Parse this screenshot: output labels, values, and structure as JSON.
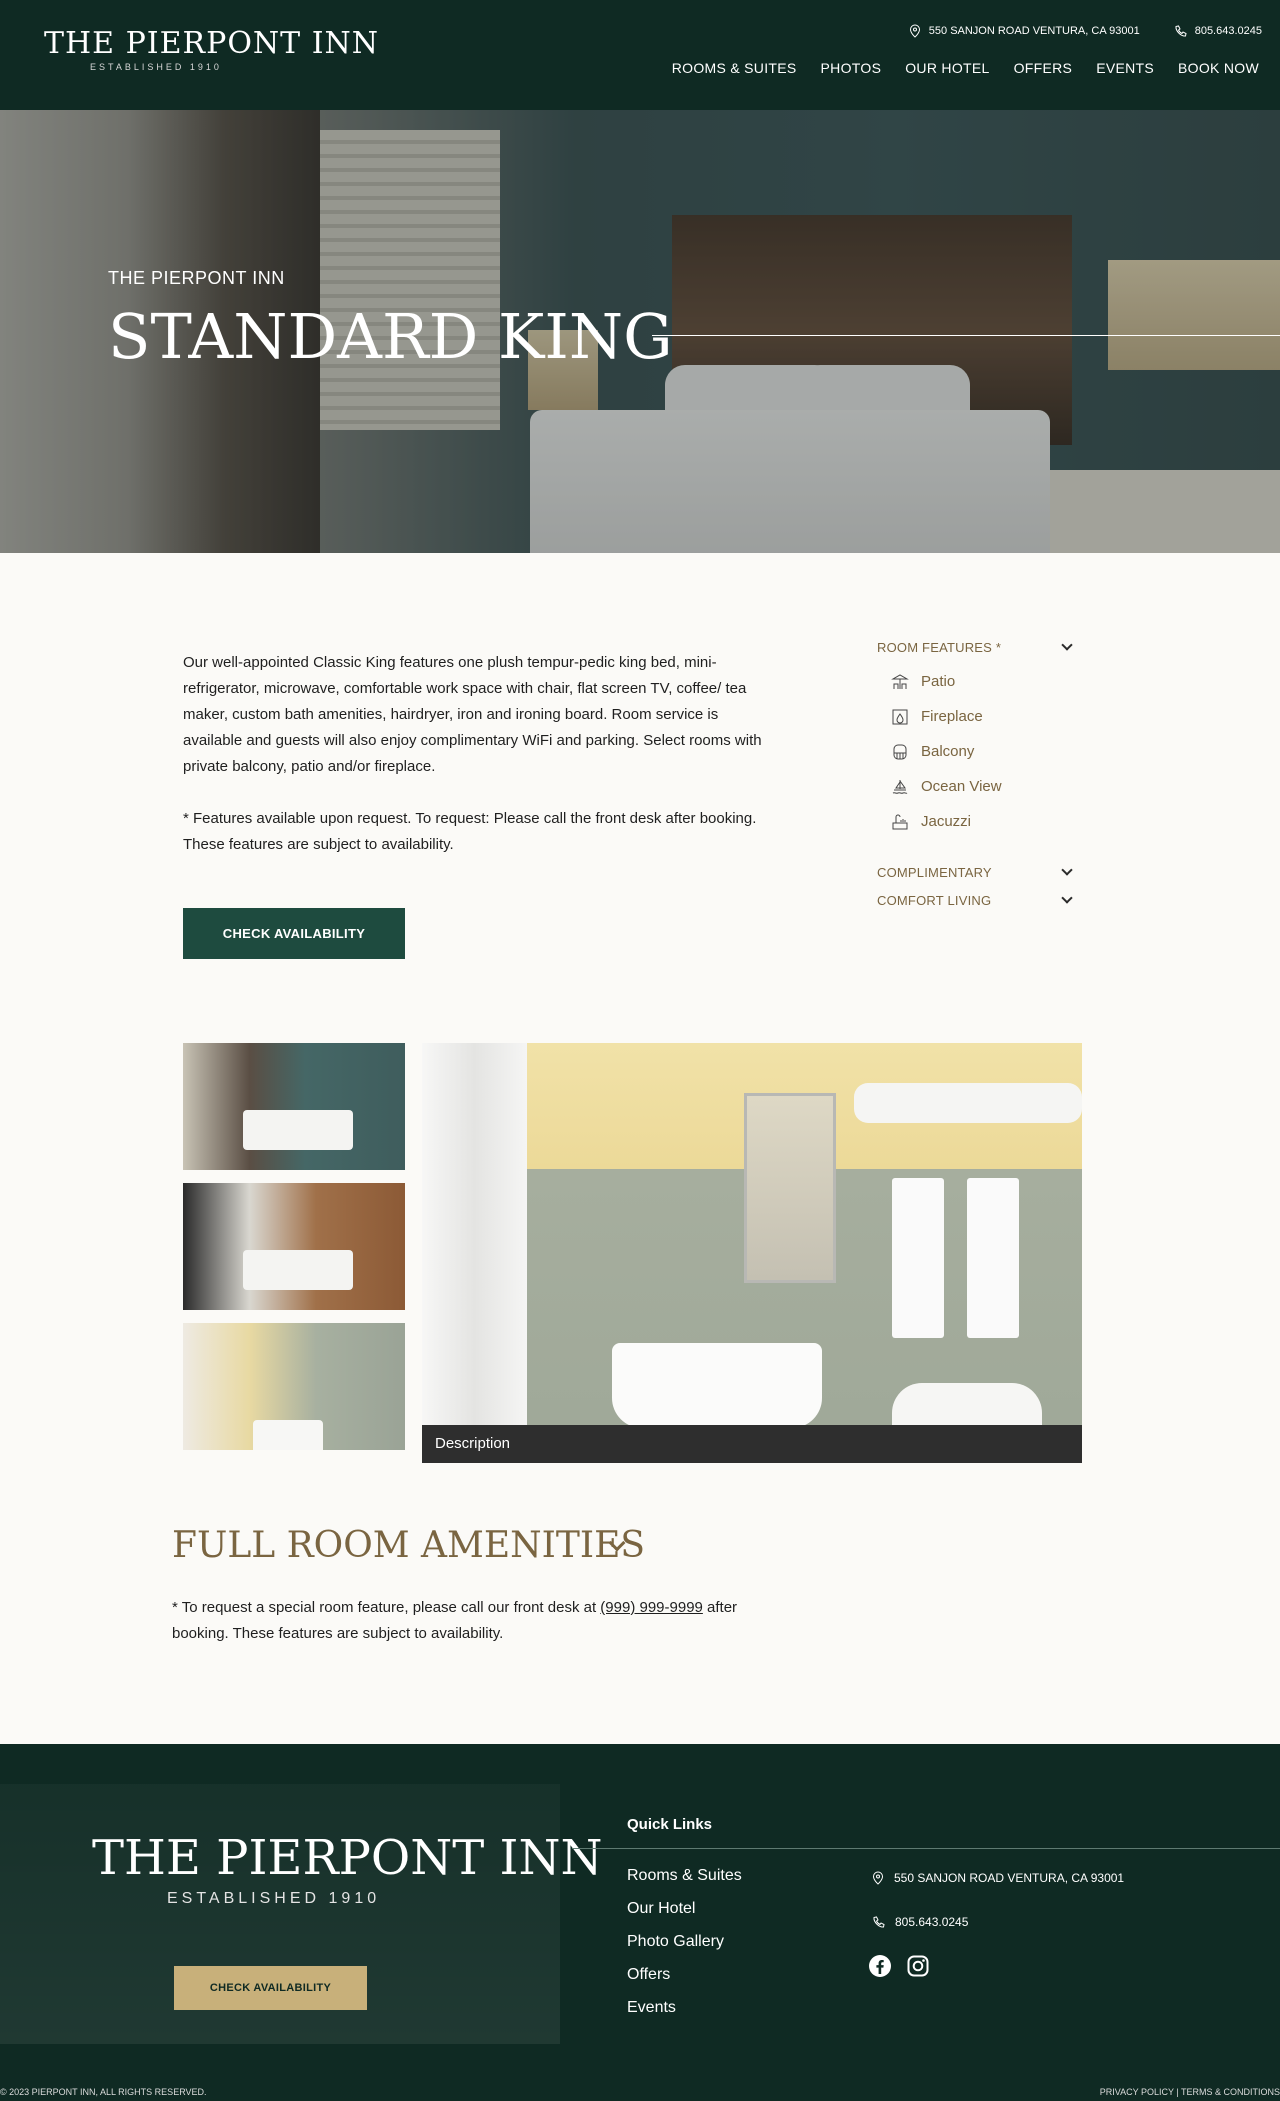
{
  "header": {
    "logo_title": "THE PIERPONT INN",
    "logo_sub": "ESTABLISHED 1910",
    "address": "550 SANJON ROAD VENTURA, CA 93001",
    "phone": "805.643.0245",
    "nav": [
      "ROOMS & SUITES",
      "PHOTOS",
      "OUR HOTEL",
      "OFFERS",
      "EVENTS",
      "BOOK NOW"
    ]
  },
  "hero": {
    "subtitle": "THE PIERPONT INN",
    "title": "STANDARD KING"
  },
  "content": {
    "description": "Our well-appointed Classic King features one plush tempur-pedic king bed, mini-refrigerator, microwave, comfortable work space with chair, flat screen TV, coffee/ tea maker, custom bath amenities, hairdryer, iron and ironing board. Room service is available and guests will also enjoy complimentary WiFi and parking. Select rooms with private balcony, patio and/or fireplace.",
    "note": "* Features available upon request. To request: Please call the front desk after booking. These features are subject to availability.",
    "check_button": "CHECK AVAILABILITY"
  },
  "features": {
    "sections": [
      {
        "title": "ROOM FEATURES *",
        "items": [
          {
            "label": "Patio",
            "icon": "patio-icon"
          },
          {
            "label": "Fireplace",
            "icon": "fireplace-icon"
          },
          {
            "label": "Balcony",
            "icon": "balcony-icon"
          },
          {
            "label": "Ocean View",
            "icon": "ocean-view-icon"
          },
          {
            "label": "Jacuzzi",
            "icon": "jacuzzi-icon"
          }
        ]
      },
      {
        "title": "COMPLIMENTARY"
      },
      {
        "title": "COMFORT LIVING"
      }
    ]
  },
  "gallery": {
    "caption": "Description"
  },
  "amenities": {
    "title": "FULL ROOM AMENITIES",
    "note_before": "* To request a special room feature, please call our front desk at ",
    "phone": "(999) 999-9999",
    "note_after": " after booking. These features are subject to availability."
  },
  "footer": {
    "logo_title": "THE PIERPONT INN",
    "logo_sub": "ESTABLISHED 1910",
    "check_button": "CHECK AVAILABILITY",
    "quick_links_title": "Quick Links",
    "quick_links": [
      "Rooms & Suites",
      "Our Hotel",
      "Photo Gallery",
      "Offers",
      "Events"
    ],
    "address": "550 SANJON ROAD VENTURA, CA 93001",
    "phone": "805.643.0245",
    "copyright": "© 2023 PIERPONT INN, ALL RIGHTS RESERVED.",
    "legal": "PRIVACY POLICY | TERMS & CONDITIONS"
  },
  "colors": {
    "brand_green": "#0f2a23",
    "button_green": "#1e4b3f",
    "gold": "#7a6541",
    "footer_button": "#c8b07a"
  }
}
